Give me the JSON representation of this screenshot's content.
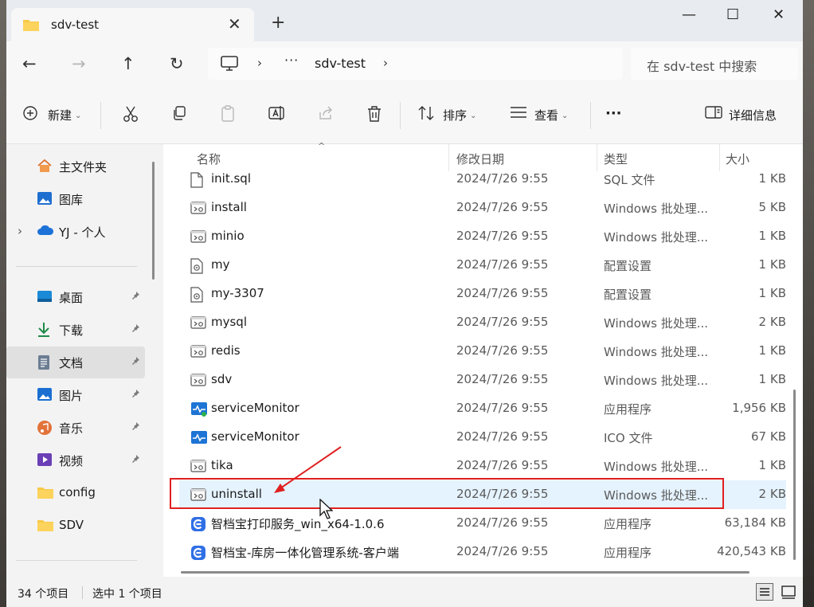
{
  "tab": {
    "title": "sdv-test",
    "close_glyph": "✕",
    "new_tab_glyph": "+"
  },
  "window": {
    "minimize": "—",
    "maximize": "☐",
    "close": "✕"
  },
  "nav": {
    "back": "←",
    "forward": "→",
    "up": "↑",
    "refresh": "↻"
  },
  "address": {
    "chevron": "›",
    "ellipsis": "···",
    "crumb": "sdv-test"
  },
  "search": {
    "placeholder": "在 sdv-test 中搜索"
  },
  "toolbar": {
    "new_label": "新建",
    "sort_label": "排序",
    "view_label": "查看",
    "more": "···",
    "details_label": "详细信息"
  },
  "sidebar": {
    "items": [
      {
        "label": "主文件夹",
        "icon": "home-icon"
      },
      {
        "label": "图库",
        "icon": "gallery-icon"
      },
      {
        "label": "YJ - 个人",
        "icon": "onedrive-cloud-icon"
      },
      {
        "label": "桌面",
        "icon": "desktop-icon"
      },
      {
        "label": "下载",
        "icon": "download-icon"
      },
      {
        "label": "文档",
        "icon": "documents-icon"
      },
      {
        "label": "图片",
        "icon": "pictures-icon"
      },
      {
        "label": "音乐",
        "icon": "music-icon"
      },
      {
        "label": "视频",
        "icon": "video-icon"
      },
      {
        "label": "config",
        "icon": "folder-icon"
      },
      {
        "label": "SDV",
        "icon": "folder-icon"
      }
    ],
    "expand_glyph": "›",
    "pin_glyph": "📌"
  },
  "columns": {
    "name": "名称",
    "date": "修改日期",
    "type": "类型",
    "size": "大小"
  },
  "files": [
    {
      "name": "init.sql",
      "date": "2024/7/26 9:55",
      "type": "SQL 文件",
      "size": "1 KB",
      "icon": "sql-file-icon"
    },
    {
      "name": "install",
      "date": "2024/7/26 9:55",
      "type": "Windows 批处理...",
      "size": "5 KB",
      "icon": "batch-file-icon"
    },
    {
      "name": "minio",
      "date": "2024/7/26 9:55",
      "type": "Windows 批处理...",
      "size": "1 KB",
      "icon": "batch-file-icon"
    },
    {
      "name": "my",
      "date": "2024/7/26 9:55",
      "type": "配置设置",
      "size": "1 KB",
      "icon": "config-file-icon"
    },
    {
      "name": "my-3307",
      "date": "2024/7/26 9:55",
      "type": "配置设置",
      "size": "1 KB",
      "icon": "config-file-icon"
    },
    {
      "name": "mysql",
      "date": "2024/7/26 9:55",
      "type": "Windows 批处理...",
      "size": "2 KB",
      "icon": "batch-file-icon"
    },
    {
      "name": "redis",
      "date": "2024/7/26 9:55",
      "type": "Windows 批处理...",
      "size": "1 KB",
      "icon": "batch-file-icon"
    },
    {
      "name": "sdv",
      "date": "2024/7/26 9:55",
      "type": "Windows 批处理...",
      "size": "1 KB",
      "icon": "batch-file-icon"
    },
    {
      "name": "serviceMonitor",
      "date": "2024/7/26 9:55",
      "type": "应用程序",
      "size": "1,956 KB",
      "icon": "app-monitor-icon"
    },
    {
      "name": "serviceMonitor",
      "date": "2024/7/26 9:55",
      "type": "ICO 文件",
      "size": "67 KB",
      "icon": "ico-monitor-icon"
    },
    {
      "name": "tika",
      "date": "2024/7/26 9:55",
      "type": "Windows 批处理...",
      "size": "1 KB",
      "icon": "batch-file-icon"
    },
    {
      "name": "uninstall",
      "date": "2024/7/26 9:55",
      "type": "Windows 批处理...",
      "size": "2 KB",
      "icon": "batch-file-icon"
    },
    {
      "name": "智档宝打印服务_win_x64-1.0.6",
      "date": "2024/7/26 9:55",
      "type": "应用程序",
      "size": "63,184 KB",
      "icon": "app-blue-icon"
    },
    {
      "name": "智档宝-库房一体化管理系统-客户端",
      "date": "2024/7/26 9:55",
      "type": "应用程序",
      "size": "420,543 KB",
      "icon": "app-blue-icon"
    }
  ],
  "status": {
    "count": "34 个项目",
    "selected": "选中 1 个项目"
  },
  "colors": {
    "accent": "#0067c0",
    "selection": "#e5f3ff",
    "annotation_red": "#e02020"
  }
}
